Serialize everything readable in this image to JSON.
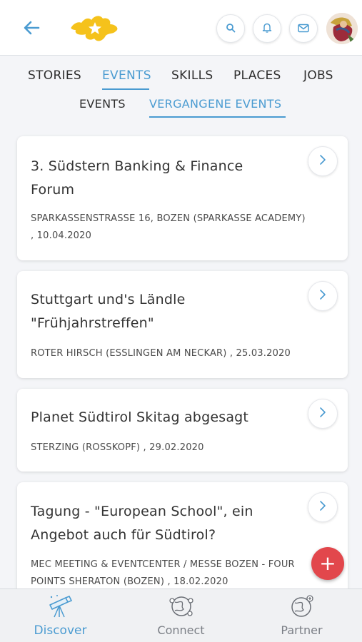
{
  "header": {
    "back_icon": "arrow-left-icon",
    "logo_icon": "star-map-logo-icon",
    "actions": [
      "search-icon",
      "bell-icon",
      "mail-icon"
    ],
    "avatar_icon": "user-avatar-icon",
    "accent_color": "#4a9bd1"
  },
  "tabs": {
    "primary": [
      "STORIES",
      "EVENTS",
      "SKILLS",
      "PLACES",
      "JOBS"
    ],
    "primary_active": "EVENTS",
    "secondary": [
      "EVENTS",
      "VERGANGENE EVENTS"
    ],
    "secondary_active": "VERGANGENE EVENTS"
  },
  "events": [
    {
      "title_lines": [
        "3. Südstern Banking & Finance",
        "Forum"
      ],
      "meta_lines": [
        "SPARKASSENSTRASSE 16, BOZEN (SPARKASSE ACADEMY)",
        ", 10.04.2020"
      ]
    },
    {
      "title_lines": [
        "Stuttgart und's Ländle",
        "\"Frühjahrstreffen\""
      ],
      "meta_lines": [
        "ROTER HIRSCH (ESSLINGEN AM NECKAR) , 25.03.2020"
      ]
    },
    {
      "title_lines": [
        "Planet Südtirol Skitag abgesagt"
      ],
      "meta_lines": [
        "STERZING (ROSSKOPF) , 29.02.2020"
      ]
    },
    {
      "title_lines": [
        "Tagung - \"European School\", ein",
        "Angebot auch für Südtirol?"
      ],
      "meta_lines": [
        "MEC MEETING & EVENTCENTER / MESSE BOZEN - FOUR",
        "POINTS SHERATON (BOZEN) , 18.02.2020"
      ]
    }
  ],
  "fab": {
    "label": "+",
    "color": "#e2474c"
  },
  "bottom_nav": [
    {
      "label": "Discover",
      "icon": "telescope-icon",
      "active": true
    },
    {
      "label": "Connect",
      "icon": "globe-network-icon",
      "active": false
    },
    {
      "label": "Partner",
      "icon": "globe-partner-icon",
      "active": false
    }
  ]
}
